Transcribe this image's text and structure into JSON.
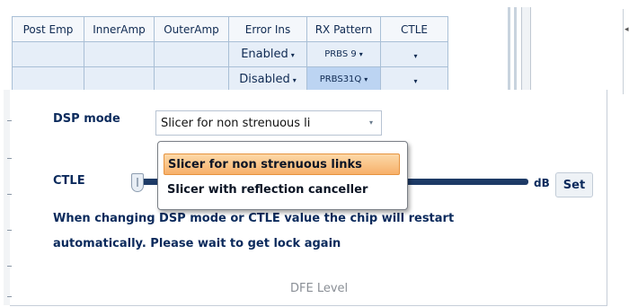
{
  "grid": {
    "headers": [
      "Post Emp",
      "InnerAmp",
      "OuterAmp",
      "Error Ins",
      "RX Pattern",
      "CTLE"
    ],
    "rows": [
      {
        "error_ins": "Enabled",
        "rx_pattern": "PRBS 9"
      },
      {
        "error_ins": "Disabled",
        "rx_pattern": "PRBS31Q"
      }
    ],
    "caret": "▾"
  },
  "dsp": {
    "label": "DSP mode",
    "selected": "Slicer for non strenuous li",
    "options": [
      "Slicer for non strenuous links",
      "Slicer with reflection canceller"
    ],
    "highlighted_option_index": 0
  },
  "ctle": {
    "label": "CTLE",
    "unit": "dB",
    "set_label": "Set"
  },
  "message": {
    "line1": "When changing DSP mode or CTLE value the chip will restart",
    "line2": "automatically. Please wait to get lock again"
  },
  "dfe": {
    "label": "DFE Level"
  },
  "colors": {
    "text": "#0b2a5c",
    "grid_cell": "#e6eef8",
    "pattern_cell": "#cfe0f6",
    "highlight": "#f7b06a",
    "slider": "#1d3a66"
  },
  "icons": {
    "caret": "caret-down-icon",
    "scroll": "scroll-left-icon"
  }
}
